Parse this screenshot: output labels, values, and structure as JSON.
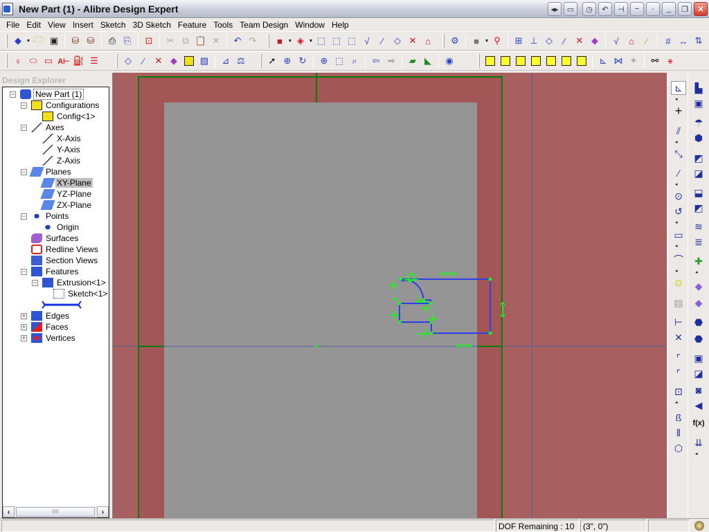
{
  "window": {
    "title": "New Part (1) - Alibre Design Expert",
    "controls": [
      "pan-left-right",
      "restore-panel",
      "clock",
      "undo-view",
      "pin",
      "minimize-bar",
      "dot",
      "minimize",
      "restore",
      "close"
    ]
  },
  "menubar": {
    "items": [
      "File",
      "Edit",
      "View",
      "Insert",
      "Sketch",
      "3D Sketch",
      "Feature",
      "Tools",
      "Team Design",
      "Window",
      "Help"
    ]
  },
  "toolbar1": {
    "items": [
      {
        "name": "new-part",
        "icon": "new-part-icon",
        "dropdown": true
      },
      {
        "name": "open",
        "icon": "folder-open-icon"
      },
      {
        "name": "save",
        "icon": "floppy-save-icon"
      },
      {
        "name": "check-out",
        "icon": "checkout-icon"
      },
      {
        "name": "check-in",
        "icon": "checkin-icon"
      },
      {
        "name": "print",
        "icon": "printer-icon"
      },
      {
        "name": "print-preview",
        "icon": "print-preview-icon"
      },
      {
        "name": "export-pdf",
        "icon": "pdf-icon"
      },
      {
        "name": "cut",
        "icon": "scissors-icon",
        "disabled": true
      },
      {
        "name": "copy",
        "icon": "copy-icon",
        "disabled": true
      },
      {
        "name": "paste",
        "icon": "paste-icon"
      },
      {
        "name": "delete",
        "icon": "delete-x-icon",
        "disabled": true
      },
      {
        "name": "undo",
        "icon": "undo-icon"
      },
      {
        "name": "redo",
        "icon": "redo-icon",
        "disabled": true
      },
      {
        "name": "display-style",
        "icon": "display-cube-icon",
        "dropdown": true
      },
      {
        "name": "filter-select",
        "icon": "filter-select-icon",
        "dropdown": true
      },
      {
        "name": "select-edges",
        "icon": "select-edges-icon"
      },
      {
        "name": "select-faces",
        "icon": "select-faces-icon"
      },
      {
        "name": "select-vertices",
        "icon": "select-vertices-icon"
      },
      {
        "name": "select-sketch",
        "icon": "select-sketch-icon"
      },
      {
        "name": "select-axes",
        "icon": "select-axes-icon"
      },
      {
        "name": "select-planes",
        "icon": "select-planes-icon"
      },
      {
        "name": "select-points",
        "icon": "select-points-icon"
      },
      {
        "name": "select-redline",
        "icon": "select-redline-icon"
      },
      {
        "name": "constraint-manager",
        "icon": "constraint-icon"
      },
      {
        "name": "shaded-cube",
        "icon": "gray-cube-icon",
        "dropdown": true
      },
      {
        "name": "show-hide-1",
        "icon": "show-hide-icon"
      },
      {
        "name": "show-hide-2",
        "icon": "show-hide-features-icon"
      },
      {
        "name": "show-hide-3",
        "icon": "show-hide-axes-icon"
      },
      {
        "name": "show-hide-4",
        "icon": "show-hide-planes-icon"
      },
      {
        "name": "show-hide-5",
        "icon": "show-hide-lines-icon"
      },
      {
        "name": "show-hide-6",
        "icon": "show-hide-points-icon"
      },
      {
        "name": "show-hide-7",
        "icon": "show-hide-surfaces-icon"
      },
      {
        "name": "show-hide-8",
        "icon": "show-hide-sketch-icon"
      },
      {
        "name": "show-hide-9",
        "icon": "show-hide-redline-icon"
      },
      {
        "name": "show-hide-10",
        "icon": "show-hide-ref-icon"
      },
      {
        "name": "show-hide-11",
        "icon": "show-hide-grid-icon"
      },
      {
        "name": "show-hide-12",
        "icon": "show-hide-dims-icon"
      },
      {
        "name": "show-hide-13",
        "icon": "show-hide-constraints-icon"
      }
    ]
  },
  "toolbar2": {
    "items": [
      {
        "name": "redline-freehand",
        "icon": "redline-freehand-icon"
      },
      {
        "name": "redline-ellipse",
        "icon": "redline-ellipse-icon"
      },
      {
        "name": "redline-rectangle",
        "icon": "redline-rectangle-icon"
      },
      {
        "name": "redline-text",
        "icon": "redline-text-icon"
      },
      {
        "name": "redline-fill",
        "icon": "redline-fill-icon"
      },
      {
        "name": "redline-lineweight",
        "icon": "redline-lineweight-icon"
      },
      {
        "name": "insert-plane",
        "icon": "plane-icon"
      },
      {
        "name": "insert-axis",
        "icon": "axis-icon"
      },
      {
        "name": "insert-point",
        "icon": "point-icon"
      },
      {
        "name": "insert-surface",
        "icon": "surface-icon"
      },
      {
        "name": "configurations",
        "icon": "table-icon"
      },
      {
        "name": "section-view",
        "icon": "section-view-icon"
      },
      {
        "name": "measure",
        "icon": "measure-icon"
      },
      {
        "name": "physical-properties",
        "icon": "balance-icon"
      },
      {
        "name": "select",
        "icon": "pointer-arrow-icon"
      },
      {
        "name": "pan",
        "icon": "pan-icon"
      },
      {
        "name": "rotate",
        "icon": "rotate-icon"
      },
      {
        "name": "zoom-in",
        "icon": "zoom-in-icon"
      },
      {
        "name": "zoom-window",
        "icon": "zoom-window-icon"
      },
      {
        "name": "zoom-fit",
        "icon": "zoom-fit-icon"
      },
      {
        "name": "previous-view",
        "icon": "back-arrow-icon"
      },
      {
        "name": "next-view",
        "icon": "forward-arrow-icon",
        "disabled": true
      },
      {
        "name": "normal-to",
        "icon": "normal-to-icon"
      },
      {
        "name": "look-at",
        "icon": "look-at-icon"
      },
      {
        "name": "render",
        "icon": "render-icon"
      },
      {
        "name": "view-front",
        "icon": "view-front-cube-icon"
      },
      {
        "name": "view-back",
        "icon": "view-back-cube-icon"
      },
      {
        "name": "view-left",
        "icon": "view-left-cube-icon"
      },
      {
        "name": "view-right",
        "icon": "view-right-cube-icon"
      },
      {
        "name": "view-top",
        "icon": "view-top-cube-icon"
      },
      {
        "name": "view-bottom",
        "icon": "view-bottom-cube-icon"
      },
      {
        "name": "view-iso",
        "icon": "view-iso-cube-icon"
      },
      {
        "name": "grid",
        "icon": "grid-icon"
      },
      {
        "name": "section-plane",
        "icon": "section-plane-icon"
      },
      {
        "name": "section-hide",
        "icon": "section-hide-icon",
        "disabled": true
      },
      {
        "name": "sketch-analysis",
        "icon": "sketch-analysis-icon"
      },
      {
        "name": "coordinate-system",
        "icon": "coordinate-system-icon"
      }
    ]
  },
  "explorer": {
    "header": "Design Explorer",
    "tree": [
      {
        "label": "New Part (1)",
        "icon": "part-icon",
        "level": 0,
        "expander": "-",
        "focused": true
      },
      {
        "label": "Configurations",
        "icon": "table-icon",
        "level": 1,
        "expander": "-"
      },
      {
        "label": "Config<1>",
        "icon": "table-icon",
        "level": 2
      },
      {
        "label": "Axes",
        "icon": "axis-icon",
        "level": 1,
        "expander": "-"
      },
      {
        "label": "X-Axis",
        "icon": "axis-icon",
        "level": 2
      },
      {
        "label": "Y-Axis",
        "icon": "axis-icon",
        "level": 2
      },
      {
        "label": "Z-Axis",
        "icon": "axis-icon",
        "level": 2
      },
      {
        "label": "Planes",
        "icon": "plane-icon",
        "level": 1,
        "expander": "-"
      },
      {
        "label": "XY-Plane",
        "icon": "plane-icon",
        "level": 2,
        "selected": true
      },
      {
        "label": "YZ-Plane",
        "icon": "plane-icon",
        "level": 2
      },
      {
        "label": "ZX-Plane",
        "icon": "plane-icon",
        "level": 2
      },
      {
        "label": "Points",
        "icon": "point-icon",
        "level": 1,
        "expander": "-"
      },
      {
        "label": "Origin",
        "icon": "point-icon",
        "level": 2
      },
      {
        "label": "Surfaces",
        "icon": "surface-icon",
        "level": 1
      },
      {
        "label": "Redline Views",
        "icon": "redline-icon",
        "level": 1
      },
      {
        "label": "Section Views",
        "icon": "section-view-icon",
        "level": 1
      },
      {
        "label": "Features",
        "icon": "feature-icon",
        "level": 1,
        "expander": "-"
      },
      {
        "label": "Extrusion<1>",
        "icon": "feature-icon",
        "level": 2,
        "expander": "-"
      },
      {
        "label": "Sketch<1>",
        "icon": "sketch-icon",
        "level": 3
      },
      {
        "label": "",
        "icon": "rollback-bar-icon",
        "level": 2,
        "rollback": true
      },
      {
        "label": "Edges",
        "icon": "edges-icon",
        "level": 1,
        "expander": "+"
      },
      {
        "label": "Faces",
        "icon": "faces-icon",
        "level": 1,
        "expander": "+"
      },
      {
        "label": "Vertices",
        "icon": "vertices-icon",
        "level": 1,
        "expander": "+"
      }
    ]
  },
  "sketch_toolbar": {
    "items": [
      "sketch-activate",
      "point-cross",
      "parallel-constraint",
      "dimension",
      "line",
      "circle",
      "arc",
      "rectangle",
      "spline",
      "point",
      "reference-figure",
      "trim",
      "intersect",
      "fillet",
      "chamfer",
      "offset",
      "mirror-region",
      "mirror",
      "project-to-sketch"
    ]
  },
  "feature_toolbar": {
    "items": [
      "extrude-boss",
      "extrude-cut",
      "revolve-boss",
      "revolve-cut",
      "loft-boss",
      "loft-cut",
      "sweep-boss",
      "sweep-cut",
      "helix-boss",
      "helix-cut",
      "insert-feature",
      "thicken",
      "replace-face",
      "fillet",
      "chamfer",
      "shell",
      "draft",
      "hole",
      "import-feature",
      "equations",
      "constraint-dims"
    ]
  },
  "statusbar": {
    "message": "",
    "dof": "DOF Remaining : 10",
    "coords": "(3\", 0\")",
    "status_icon": "globe-status-icon"
  },
  "colors": {
    "viewport_bg": "#a85f5f",
    "part_face": "#959595",
    "plane_edge": "#0a7a0a",
    "sketch_line": "#2f3fe8",
    "constraint_marker": "#22ee22",
    "axis_line": "#4d63a8"
  }
}
